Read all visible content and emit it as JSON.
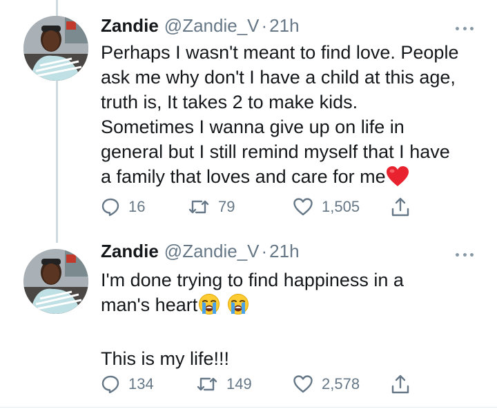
{
  "tweets": [
    {
      "name": "Zandie",
      "handle": "@Zandie_V",
      "separator": "·",
      "time": "21h",
      "lines": [
        "Perhaps I wasn't meant to find love. People",
        "ask me why don't I have a child at this age,",
        "truth is, It takes 2 to make kids.",
        "Sometimes I wanna give up on life in",
        "general but I still remind myself that I have",
        "a family that loves and care for me"
      ],
      "emoji": [
        "red-heart"
      ],
      "replies": "16",
      "retweets": "79",
      "likes": "1,505"
    },
    {
      "name": "Zandie",
      "handle": "@Zandie_V",
      "separator": "·",
      "time": "21h",
      "lines": [
        "I'm done trying to find happiness in a",
        "man's heart",
        "",
        "This is my life!!!"
      ],
      "emoji": [
        "loudly-crying-face",
        "loudly-crying-face"
      ],
      "replies": "134",
      "retweets": "149",
      "likes": "2,578"
    }
  ],
  "colors": {
    "text": "#14171a",
    "secondary": "#657786",
    "thread_line": "#cfd9de",
    "heart": "#e0245e"
  },
  "icons": [
    "reply-icon",
    "retweet-icon",
    "like-icon",
    "share-icon",
    "more-icon"
  ]
}
